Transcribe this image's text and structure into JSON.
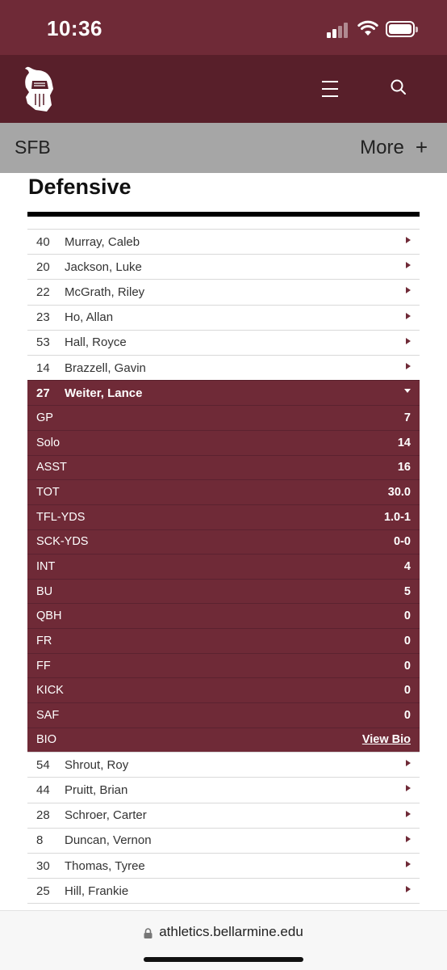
{
  "status": {
    "time": "10:36"
  },
  "header": {
    "logo_icon": "knight-helmet-icon",
    "menu_icon": "hamburger-icon",
    "search_icon": "search-icon"
  },
  "subbar": {
    "title": "SFB",
    "more_label": "More",
    "more_icon": "plus-icon"
  },
  "section": {
    "heading": "Defensive"
  },
  "roster_before": [
    {
      "num": "40",
      "name": "Murray, Caleb"
    },
    {
      "num": "20",
      "name": "Jackson, Luke"
    },
    {
      "num": "22",
      "name": "McGrath, Riley"
    },
    {
      "num": "23",
      "name": "Ho, Allan"
    },
    {
      "num": "53",
      "name": "Hall, Royce"
    },
    {
      "num": "14",
      "name": "Brazzell, Gavin"
    }
  ],
  "expanded_player": {
    "num": "27",
    "name": "Weiter, Lance",
    "stats": [
      {
        "label": "GP",
        "value": "7"
      },
      {
        "label": "Solo",
        "value": "14"
      },
      {
        "label": "ASST",
        "value": "16"
      },
      {
        "label": "TOT",
        "value": "30.0"
      },
      {
        "label": "TFL-YDS",
        "value": "1.0-1"
      },
      {
        "label": "SCK-YDS",
        "value": "0-0"
      },
      {
        "label": "INT",
        "value": "4"
      },
      {
        "label": "BU",
        "value": "5"
      },
      {
        "label": "QBH",
        "value": "0"
      },
      {
        "label": "FR",
        "value": "0"
      },
      {
        "label": "FF",
        "value": "0"
      },
      {
        "label": "KICK",
        "value": "0"
      },
      {
        "label": "SAF",
        "value": "0"
      }
    ],
    "bio_label": "BIO",
    "bio_link": "View Bio"
  },
  "roster_after": [
    {
      "num": "54",
      "name": "Shrout, Roy"
    },
    {
      "num": "44",
      "name": "Pruitt, Brian"
    },
    {
      "num": "28",
      "name": "Schroer, Carter"
    },
    {
      "num": "8",
      "name": "Duncan, Vernon"
    },
    {
      "num": "30",
      "name": "Thomas, Tyree"
    },
    {
      "num": "25",
      "name": "Hill, Frankie"
    }
  ],
  "browser": {
    "url": "athletics.bellarmine.edu"
  },
  "colors": {
    "maroon": "#6f2a37",
    "maroon_dark": "#581f2a",
    "subbar_gray": "#a6a6a6"
  }
}
